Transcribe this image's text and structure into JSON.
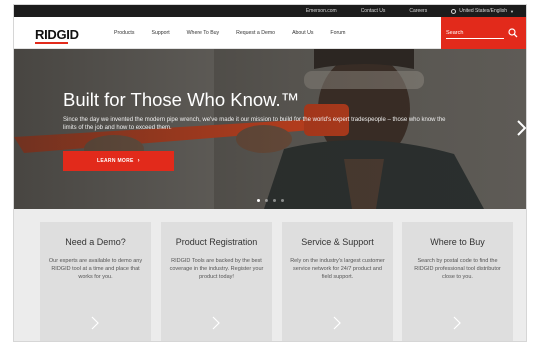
{
  "utility_bar": {
    "links": [
      "Emerson.com",
      "Contact Us",
      "Careers"
    ],
    "locale": "United States/English"
  },
  "header": {
    "logo": "RIDGID",
    "nav": [
      "Products",
      "Support",
      "Where To Buy",
      "Request a Demo",
      "About Us",
      "Forum"
    ],
    "search_placeholder": "Search"
  },
  "hero": {
    "title": "Built for Those Who Know.™",
    "subtitle": "Since the day we invented the modern pipe wrench, we've made it our mission to build for the world's expert tradespeople – those who know the limits of the job and how to exceed them.",
    "cta_label": "LEARN MORE"
  },
  "cards": [
    {
      "title": "Need a Demo?",
      "body": "Our experts are available to demo any RIDGID tool at a time and place that works for you."
    },
    {
      "title": "Product Registration",
      "body": "RIDGID Tools are backed by the best coverage in the industry. Register your product today!"
    },
    {
      "title": "Service & Support",
      "body": "Rely on the industry's largest customer service network for 24/7 product and field support."
    },
    {
      "title": "Where to Buy",
      "body": "Search by postal code to find the RIDGID professional tool distributor close to you."
    }
  ],
  "colors": {
    "brand_red": "#e22a1b",
    "utility_bg": "#1c1c1c",
    "card_bg": "#dedede"
  }
}
